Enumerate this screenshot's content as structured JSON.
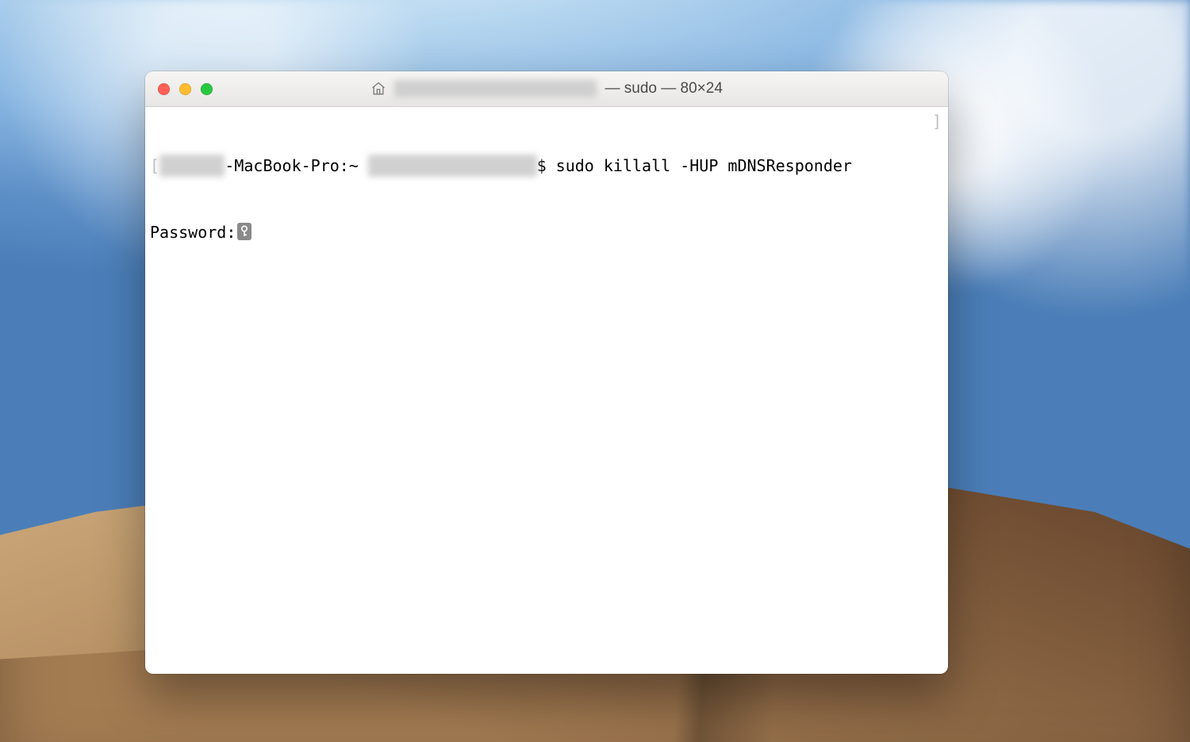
{
  "window": {
    "title_path_redacted": "████████████████",
    "title_suffix": " — sudo — 80×24",
    "traffic": {
      "close": "close",
      "minimize": "minimize",
      "zoom": "zoom"
    }
  },
  "terminal": {
    "line1": {
      "lbracket": "[",
      "host_redacted": "██████",
      "host_suffix": "-MacBook-Pro:~ ",
      "user_redacted": "████████████████",
      "prompt": "$ ",
      "command": "sudo killall -HUP mDNSResponder",
      "rbracket": "]"
    },
    "line2": {
      "label": "Password:",
      "key_icon": "key-icon"
    }
  }
}
